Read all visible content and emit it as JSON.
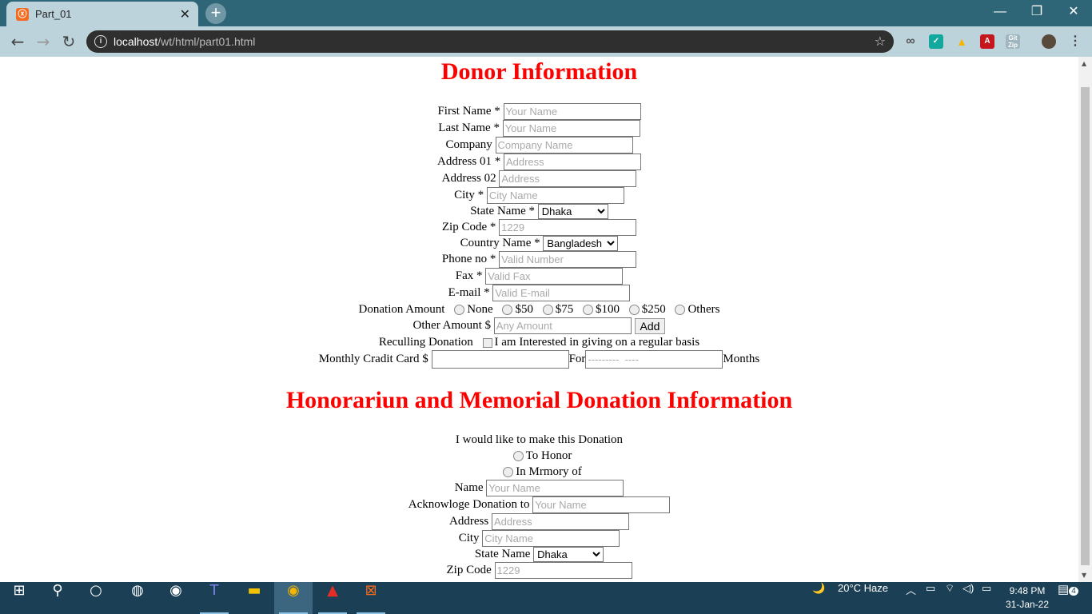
{
  "browser": {
    "tab_title": "Part_01",
    "tab_close": "✕",
    "new_tab": "+",
    "url_host": "localhost",
    "url_path": "/wt/html/part01.html",
    "window_controls": [
      "—",
      "❐",
      "✕"
    ],
    "extensions": [
      "infinity-icon",
      "stackby-icon",
      "google-drive-icon",
      "acrobat-icon",
      "gitzip-icon",
      "profile-avatar",
      "more-icon"
    ]
  },
  "donor": {
    "title": "Donor Information",
    "first_name": {
      "label": "First Name *",
      "placeholder": "Your Name"
    },
    "last_name": {
      "label": "Last Name *",
      "placeholder": "Your Name"
    },
    "company": {
      "label": "Company",
      "placeholder": "Company Name"
    },
    "address1": {
      "label": "Address 01 *",
      "placeholder": "Address"
    },
    "address2": {
      "label": "Address 02",
      "placeholder": "Address"
    },
    "city": {
      "label": "City *",
      "placeholder": "City Name"
    },
    "state": {
      "label": "State Name *",
      "value": "Dhaka"
    },
    "zip": {
      "label": "Zip Code *",
      "placeholder": "1229"
    },
    "country": {
      "label": "Country Name *",
      "value": "Bangladesh"
    },
    "phone": {
      "label": "Phone no *",
      "placeholder": "Valid Number"
    },
    "fax": {
      "label": "Fax *",
      "placeholder": "Valid Fax"
    },
    "email": {
      "label": "E-mail *",
      "placeholder": "Valid E-mail"
    },
    "donation_amount": {
      "label": "Donation Amount",
      "options": [
        "None",
        "$50",
        "$75",
        "$100",
        "$250",
        "Others"
      ]
    },
    "other_amount": {
      "label": "Other Amount $",
      "placeholder": "Any Amount",
      "button": "Add"
    },
    "recurring": {
      "label": "Reculling Donation",
      "checkbox_label": "I am Interested in giving on a regular basis"
    },
    "monthly": {
      "label": "Monthly Cradit Card $",
      "for_label": "For",
      "months_placeholder": "---------  ----",
      "months_label": "Months"
    }
  },
  "honor": {
    "title": "Honorariun and Memorial Donation Information",
    "intro": "I would like to make this Donation",
    "to_honor": "To Honor",
    "in_memory": "In Mrmory of",
    "name": {
      "label": "Name",
      "placeholder": "Your Name"
    },
    "acknowledge": {
      "label": "Acknowloge Donation to",
      "placeholder": "Your Name"
    },
    "address": {
      "label": "Address",
      "placeholder": "Address"
    },
    "city": {
      "label": "City",
      "placeholder": "City Name"
    },
    "state": {
      "label": "State Name",
      "value": "Dhaka"
    },
    "zip": {
      "label": "Zip Code",
      "placeholder": "1229"
    }
  },
  "taskbar": {
    "weather": "20°C  Haze",
    "time": "9:48 PM",
    "date": "31-Jan-22",
    "notifications": "4"
  }
}
